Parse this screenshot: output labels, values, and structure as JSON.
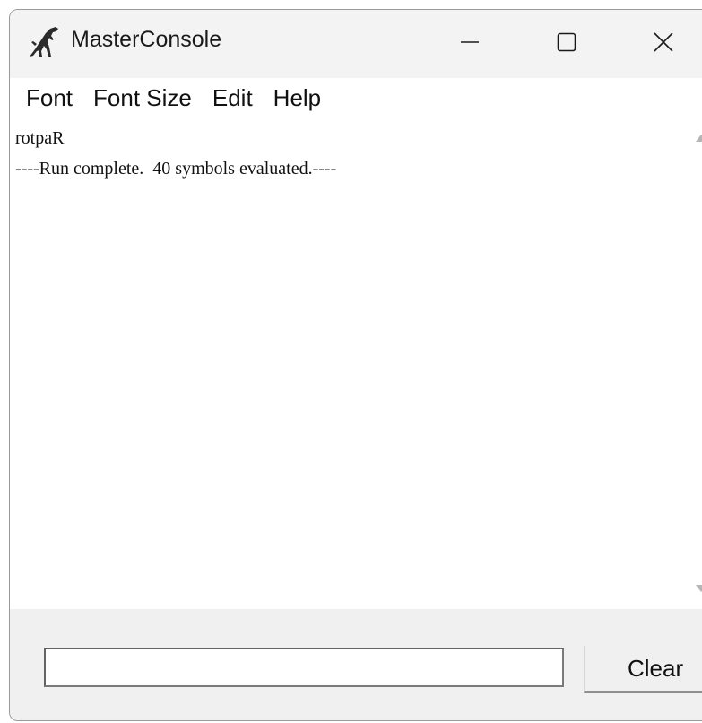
{
  "window": {
    "title": "MasterConsole",
    "app_icon": "trex-icon",
    "controls": {
      "minimize_icon": "minimize-icon",
      "maximize_icon": "maximize-icon",
      "close_icon": "close-icon"
    }
  },
  "menubar": {
    "items": [
      {
        "label": "Font"
      },
      {
        "label": "Font Size"
      },
      {
        "label": "Edit"
      },
      {
        "label": "Help"
      }
    ]
  },
  "console": {
    "lines": [
      "rotpaR",
      "----Run complete.  40 symbols evaluated.----"
    ]
  },
  "scrollbar": {
    "up_icon": "scroll-up-arrow-icon",
    "down_icon": "scroll-down-arrow-icon"
  },
  "command": {
    "value": "",
    "placeholder": ""
  },
  "buttons": {
    "clear_label": "Clear"
  },
  "colors": {
    "window_bg": "#f0f0f0",
    "text_area_bg": "#ffffff",
    "text": "#111111"
  }
}
